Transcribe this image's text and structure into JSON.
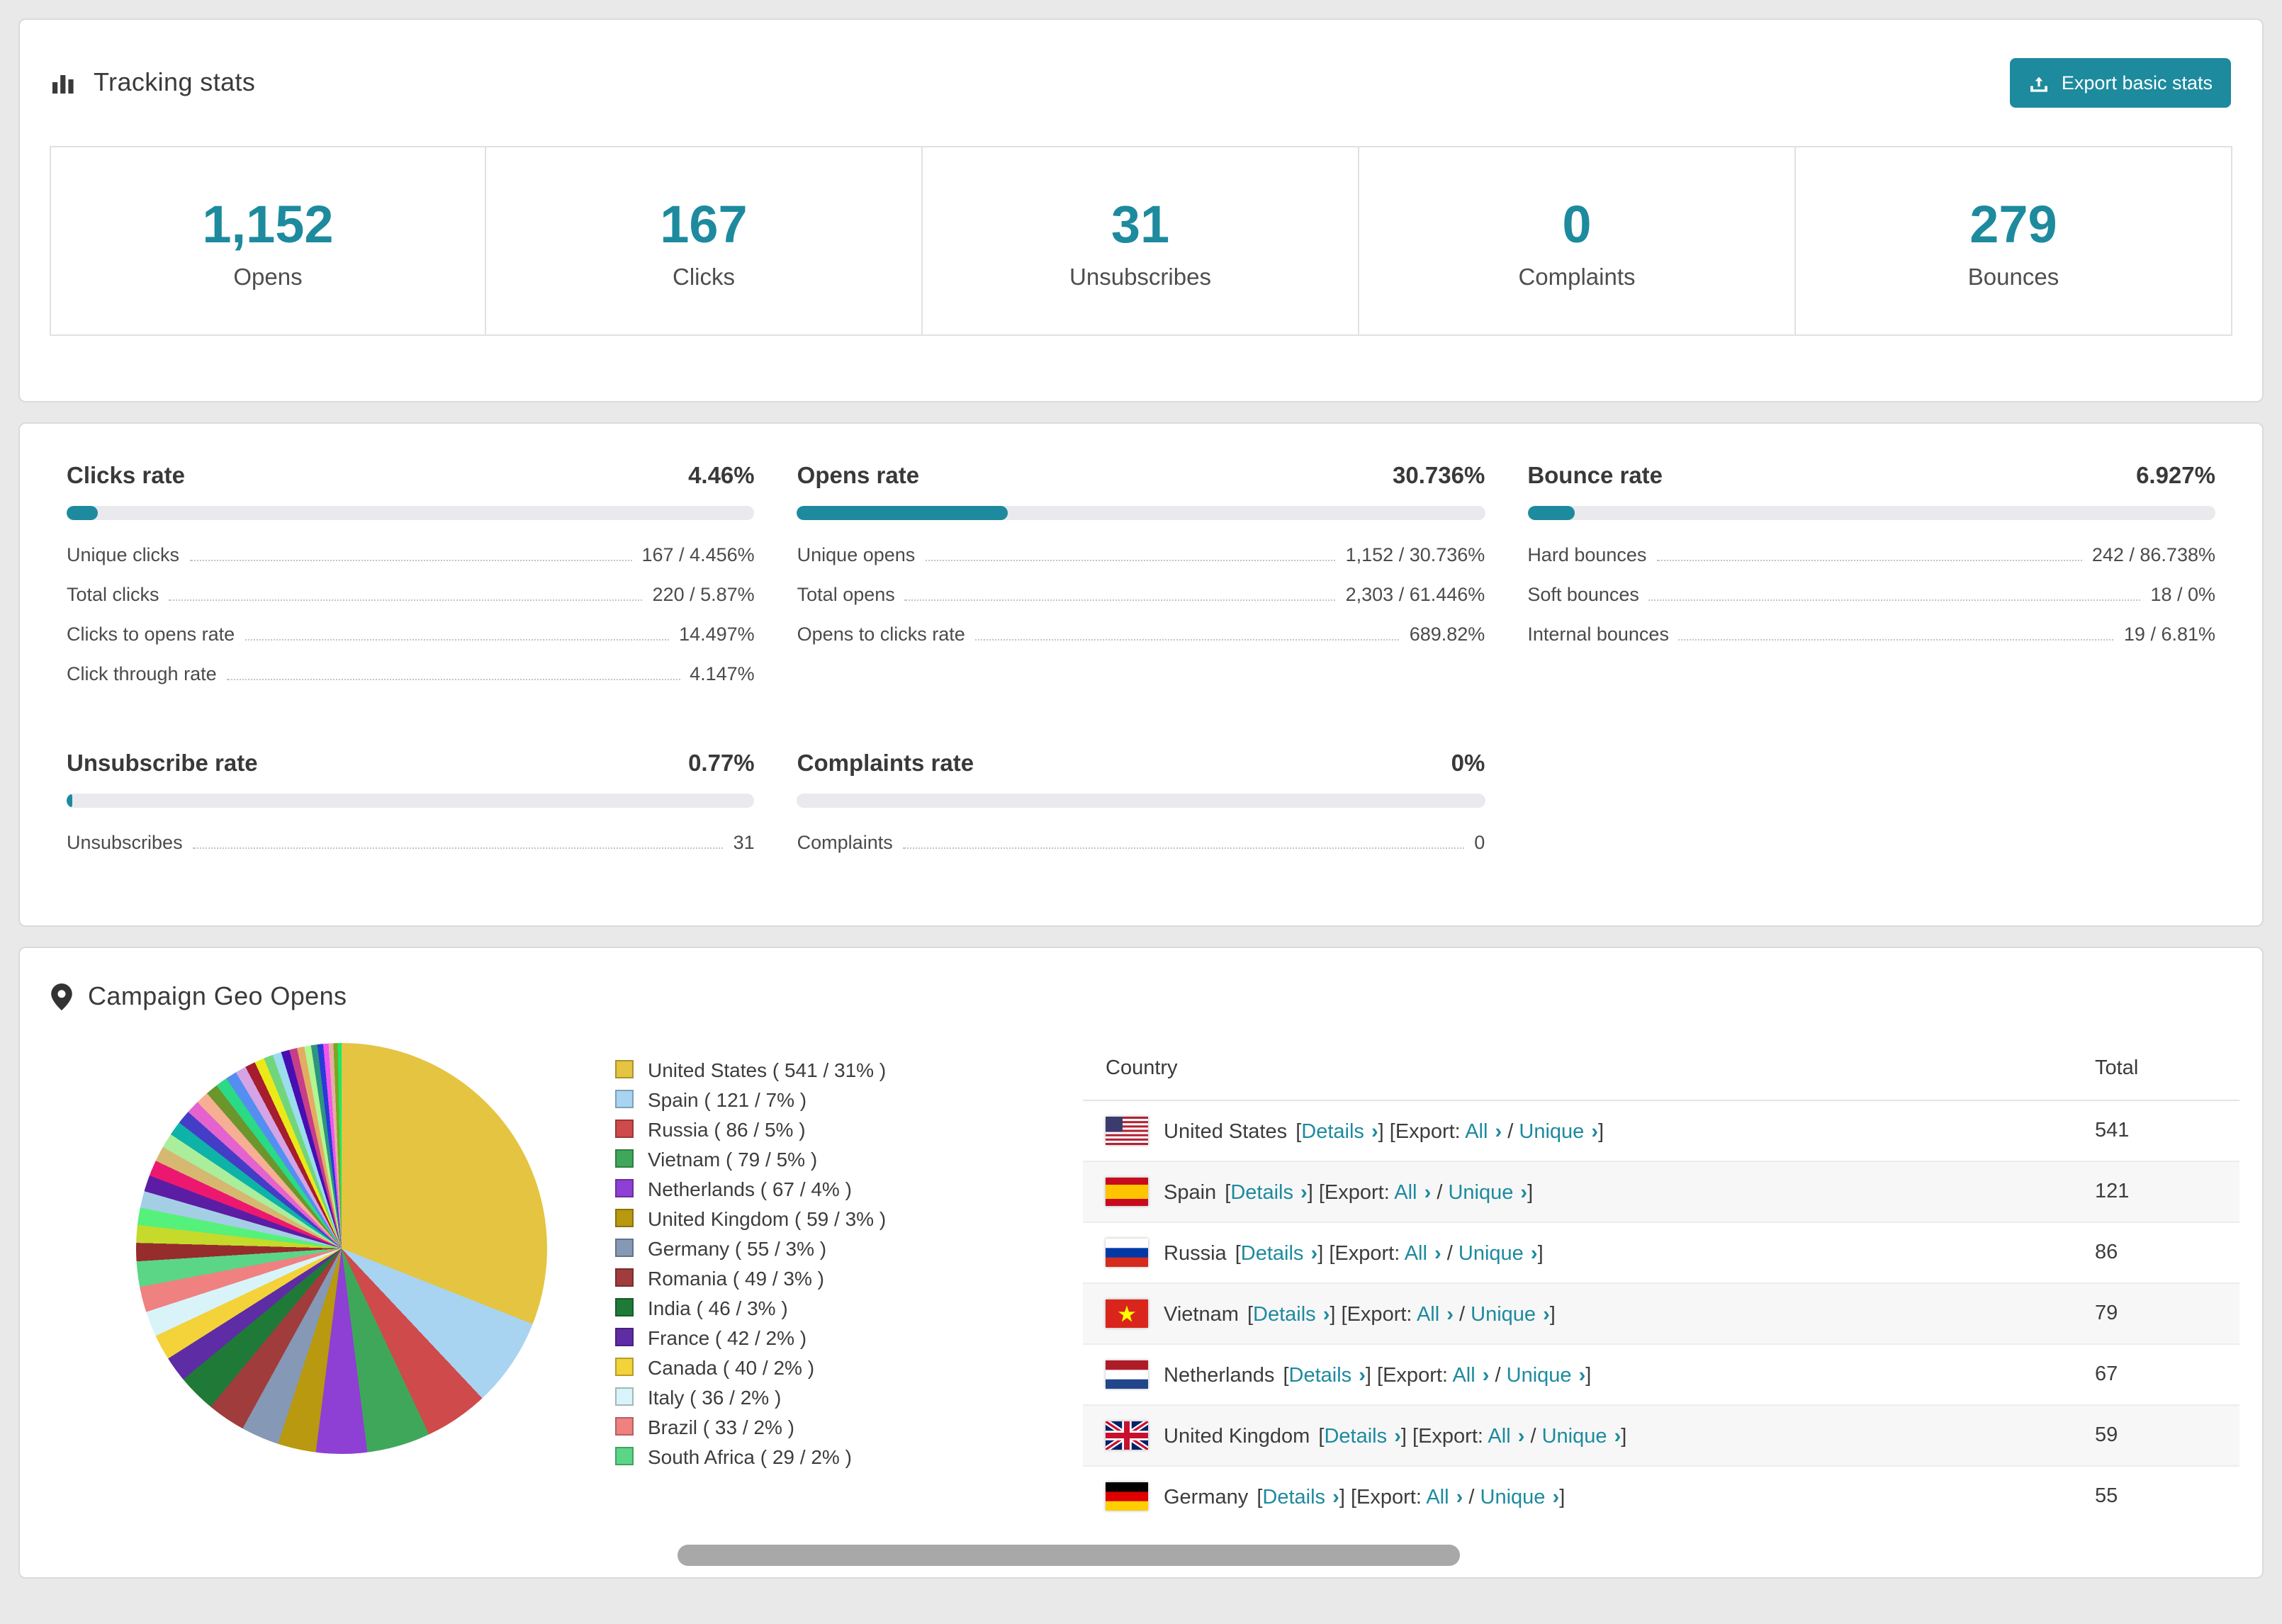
{
  "colors": {
    "accent": "#1d8a9e"
  },
  "tracking": {
    "title": "Tracking stats",
    "export_button_label": "Export basic stats",
    "stats": [
      {
        "value": "1,152",
        "label": "Opens"
      },
      {
        "value": "167",
        "label": "Clicks"
      },
      {
        "value": "31",
        "label": "Unsubscribes"
      },
      {
        "value": "0",
        "label": "Complaints"
      },
      {
        "value": "279",
        "label": "Bounces"
      }
    ]
  },
  "rates": [
    {
      "title": "Clicks rate",
      "value": "4.46%",
      "percent": 4.46,
      "rows": [
        [
          "Unique clicks",
          "167 / 4.456%"
        ],
        [
          "Total clicks",
          "220 / 5.87%"
        ],
        [
          "Clicks to opens rate",
          "14.497%"
        ],
        [
          "Click through rate",
          "4.147%"
        ]
      ]
    },
    {
      "title": "Opens rate",
      "value": "30.736%",
      "percent": 30.736,
      "rows": [
        [
          "Unique opens",
          "1,152 / 30.736%"
        ],
        [
          "Total opens",
          "2,303 / 61.446%"
        ],
        [
          "Opens to clicks rate",
          "689.82%"
        ]
      ]
    },
    {
      "title": "Bounce rate",
      "value": "6.927%",
      "percent": 6.927,
      "rows": [
        [
          "Hard bounces",
          "242 / 86.738%"
        ],
        [
          "Soft bounces",
          "18 / 0%"
        ],
        [
          "Internal bounces",
          "19 / 6.81%"
        ]
      ]
    },
    {
      "title": "Unsubscribe rate",
      "value": "0.77%",
      "percent": 0.77,
      "rows": [
        [
          "Unsubscribes",
          "31"
        ]
      ]
    },
    {
      "title": "Complaints rate",
      "value": "0%",
      "percent": 0,
      "rows": [
        [
          "Complaints",
          "0"
        ]
      ]
    }
  ],
  "geo": {
    "title": "Campaign Geo Opens",
    "table": {
      "headers": [
        "Country",
        "Total"
      ],
      "details_label": "Details",
      "export_label": "Export:",
      "all_label": "All",
      "unique_label": "Unique",
      "bracket_open": "[",
      "bracket_close": "]",
      "separator": "/",
      "rows": [
        {
          "country": "United States",
          "flag": "us",
          "total": "541"
        },
        {
          "country": "Spain",
          "flag": "es",
          "total": "121"
        },
        {
          "country": "Russia",
          "flag": "ru",
          "total": "86"
        },
        {
          "country": "Vietnam",
          "flag": "vn",
          "total": "79"
        },
        {
          "country": "Netherlands",
          "flag": "nl",
          "total": "67"
        },
        {
          "country": "United Kingdom",
          "flag": "gb",
          "total": "59"
        },
        {
          "country": "Germany",
          "flag": "de",
          "total": "55"
        }
      ]
    }
  },
  "chart_data": {
    "type": "pie",
    "title": "Campaign Geo Opens",
    "legend_position": "right",
    "legend_format": "{label} ( {value} / {percent}% )",
    "slices": [
      {
        "label": "United States",
        "value": 541,
        "percent": 31,
        "color": "#e4c441"
      },
      {
        "label": "Spain",
        "value": 121,
        "percent": 7,
        "color": "#a8d4f2"
      },
      {
        "label": "Russia",
        "value": 86,
        "percent": 5,
        "color": "#cf4a4a"
      },
      {
        "label": "Vietnam",
        "value": 79,
        "percent": 5,
        "color": "#3fa75a"
      },
      {
        "label": "Netherlands",
        "value": 67,
        "percent": 4,
        "color": "#8e3fd4"
      },
      {
        "label": "United Kingdom",
        "value": 59,
        "percent": 3,
        "color": "#b8990f"
      },
      {
        "label": "Germany",
        "value": 55,
        "percent": 3,
        "color": "#8598b6"
      },
      {
        "label": "Romania",
        "value": 49,
        "percent": 3,
        "color": "#a03c3c"
      },
      {
        "label": "India",
        "value": 46,
        "percent": 3,
        "color": "#1f7a37"
      },
      {
        "label": "France",
        "value": 42,
        "percent": 2,
        "color": "#5e2ca5"
      },
      {
        "label": "Canada",
        "value": 40,
        "percent": 2,
        "color": "#f3d23a"
      },
      {
        "label": "Italy",
        "value": 36,
        "percent": 2,
        "color": "#d8f4f8"
      },
      {
        "label": "Brazil",
        "value": 33,
        "percent": 2,
        "color": "#ef8181"
      },
      {
        "label": "South Africa",
        "value": 29,
        "percent": 2,
        "color": "#5ad686"
      }
    ],
    "others_percent": 26
  }
}
